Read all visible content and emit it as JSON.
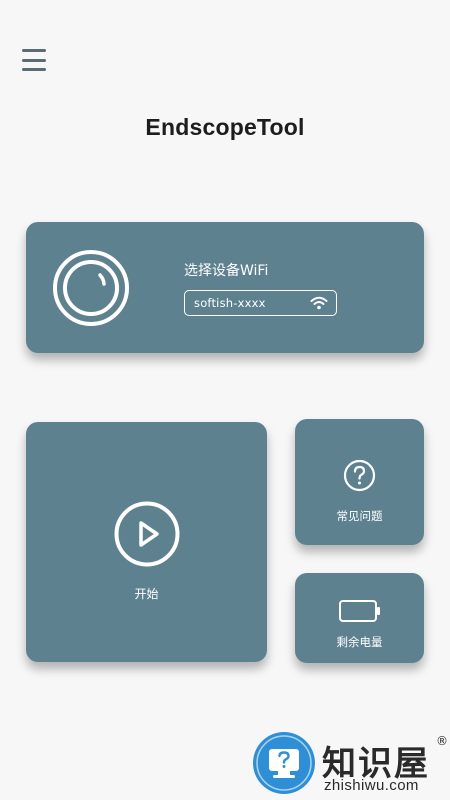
{
  "header": {
    "menu_icon": "hamburger-menu-icon",
    "title": "EndscopeTool"
  },
  "wifi_card": {
    "icon": "camera-lens-icon",
    "label": "选择设备WiFi",
    "selected_wifi": "softish-xxxx",
    "wifi_icon": "wifi-signal-icon"
  },
  "start_card": {
    "icon": "play-circle-icon",
    "label": "开始"
  },
  "faq_card": {
    "icon": "question-circle-icon",
    "label": "常见问题"
  },
  "battery_card": {
    "icon": "battery-icon",
    "label": "剩余电量"
  },
  "watermark": {
    "brand": "知识屋",
    "registered": "®",
    "domain": "zhishiwu.com"
  },
  "colors": {
    "card": "#5e8190",
    "background": "#f7f7f7",
    "title": "#1d1d1d",
    "menu_icon": "#5b6b72",
    "watermark_blue": "#2f8fd6"
  }
}
